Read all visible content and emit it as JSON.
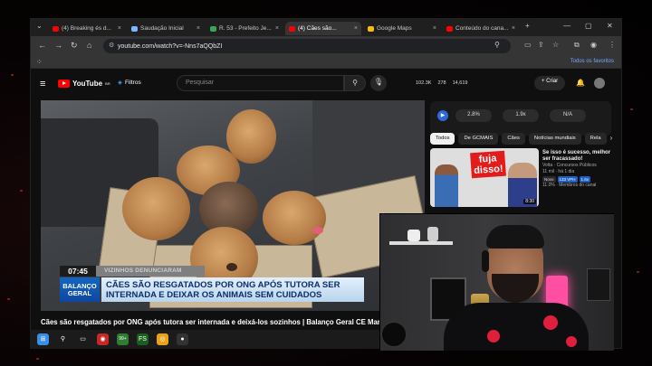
{
  "browser": {
    "tabs": [
      {
        "label": "(4) Breaking és d...",
        "favicon_color": "#ff0000",
        "active": false
      },
      {
        "label": "Saudação Inicial",
        "favicon_color": "#7ab8ff",
        "active": false
      },
      {
        "label": "R. 53 - Prefeito Je...",
        "favicon_color": "#34a853",
        "active": false
      },
      {
        "label": "(4) Cães são...",
        "favicon_color": "#ff0000",
        "active": true
      },
      {
        "label": "Google Maps",
        "favicon_color": "#fbbc04",
        "active": false
      },
      {
        "label": "Conteúdo do cana...",
        "favicon_color": "#ff0000",
        "active": false
      }
    ],
    "url": "youtube.com/watch?v=-Nns7aQQbZI",
    "bookmarks_all": "Todos os favoritos"
  },
  "youtube": {
    "logo": "YouTube",
    "country": "BR",
    "filters_label": "Filtros",
    "search_placeholder": "Pesquisar",
    "stats": [
      "102.3K",
      "278",
      "14,619"
    ],
    "create_label": "Criar",
    "mini_bar": {
      "values": [
        "2.8%",
        "1.9x",
        "N/A"
      ]
    },
    "chips": [
      "Todos",
      "De GCMAIS",
      "Cães",
      "Notícias mundiais",
      "Rela"
    ],
    "recommendation": {
      "title": "Se isso é sucesso, melhor ser fracassado!",
      "channel": "Volta · Concursos Públicos",
      "views": "11 mil · há 1 dia",
      "badge_new": "Novo",
      "badge_vph": "133 VPH",
      "badge_score": "1.6x",
      "extra": "11.0% · Membros do canal",
      "thumb_text": "fuja disso!",
      "duration": "8:30"
    }
  },
  "video": {
    "clock": "07:45",
    "tag": "VIZINHOS DENUNCIARAM",
    "program_logo": "BALANÇO GERAL",
    "headline": "CÃES SÃO RESGATADOS POR ONG APÓS TUTORA SER INTERNADA E DEIXAR OS ANIMAIS SEM CUIDADOS",
    "title": "Cães são resgatados por ONG após tutora ser internada e deixá-los sozinhos | Balanço Geral CE Manhã"
  },
  "taskbar": {
    "items": [
      {
        "name": "windows-start-icon",
        "color": "#3a8ee6",
        "glyph": "⊞"
      },
      {
        "name": "search-icon",
        "color": "#1b1b1b",
        "glyph": "⚲"
      },
      {
        "name": "task-view-icon",
        "color": "#1b1b1b",
        "glyph": "▭"
      },
      {
        "name": "app-red-icon",
        "color": "#c62828",
        "glyph": "◉"
      },
      {
        "name": "app-green-icon",
        "color": "#2e7d32",
        "glyph": "99+"
      },
      {
        "name": "app-gfs-icon",
        "color": "#1b5e20",
        "glyph": "FS"
      },
      {
        "name": "chrome-icon",
        "color": "#e8a317",
        "glyph": "◎"
      },
      {
        "name": "obs-icon",
        "color": "#333333",
        "glyph": "●"
      }
    ]
  },
  "colors": {
    "accent_red": "#ff0000",
    "headline_blue": "#0b2e6b",
    "highlight_pink": "#ff4fa3"
  }
}
